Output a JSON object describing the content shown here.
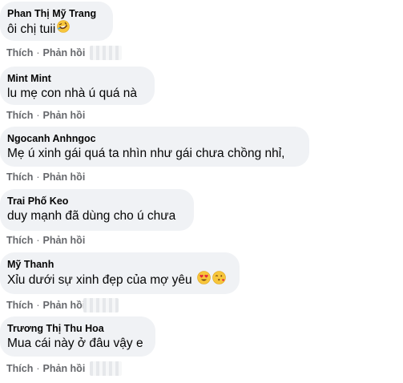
{
  "comments": [
    {
      "author": "Phan Thị Mỹ Trang",
      "text": "ôi chị tuii",
      "emojis": [
        "rolling-laughing-emoji"
      ],
      "like": "Thích",
      "reply": "Phản hồi"
    },
    {
      "author": "Mint Mint",
      "text": "lu mẹ con nhà ú quá nà",
      "emojis": [],
      "like": "Thích",
      "reply": "Phản hồi"
    },
    {
      "author": "Ngocanh Anhngoc",
      "text": "Mẹ ú xinh gái quá ta nhìn như gái chưa chồng nhỉ,",
      "emojis": [],
      "like": "Thích",
      "reply": "Phản hồi"
    },
    {
      "author": "Trai Phố Keo",
      "text": "duy mạnh đã dùng cho ú chưa",
      "emojis": [],
      "like": "Thích",
      "reply": "Phản hồi"
    },
    {
      "author": "Mỹ Thanh",
      "text": "Xỉu dưới sự xinh đẹp của mợ yêu",
      "emojis": [
        "heart-eyes-emoji",
        "kissing-heart-emoji"
      ],
      "like": "Thích",
      "reply": "Phản hồi"
    },
    {
      "author": "Trương Thị Thu Hoa",
      "text": "Mua cái này ở đâu vậy e",
      "emojis": [],
      "like": "Thích",
      "reply": "Phản hồi"
    }
  ],
  "colors": {
    "bubble": "#f0f2f5",
    "action_text": "#65676b",
    "text": "#050505"
  }
}
